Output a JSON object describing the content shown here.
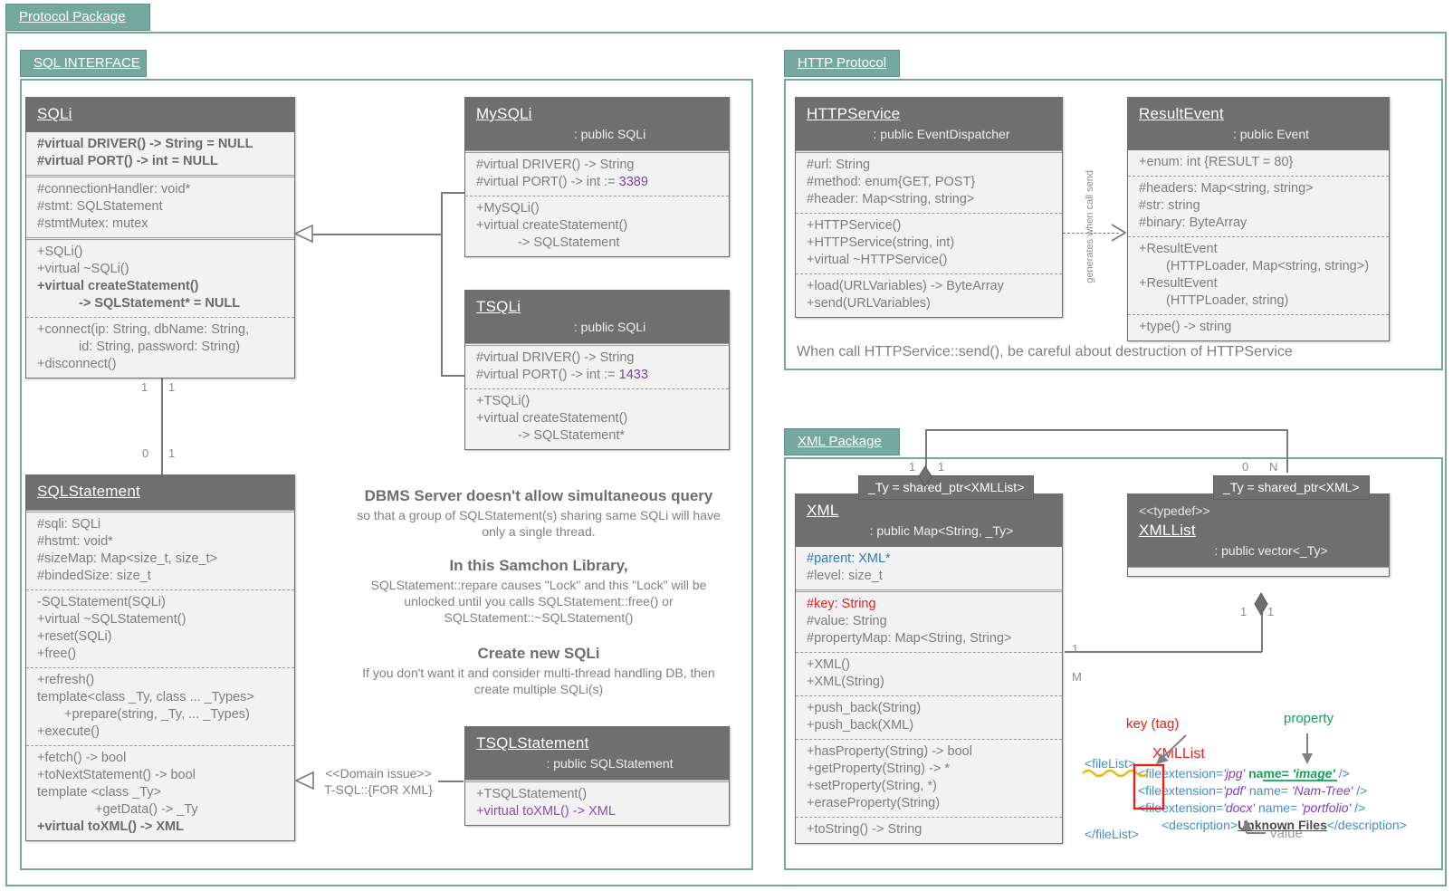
{
  "packages": {
    "protocol": {
      "title": "Protocol Package"
    },
    "sql_interface": {
      "title": "SQL INTERFACE"
    },
    "http": {
      "title": "HTTP Protocol"
    },
    "xml": {
      "title": "XML Package"
    }
  },
  "classes": {
    "sqli": {
      "name": "SQLi",
      "sections": [
        [
          "#virtual DRIVER() -> String = NULL",
          "#virtual PORT() -> int = NULL"
        ],
        [
          "#connectionHandler: void*",
          "#stmt: SQLStatement",
          "#stmtMutex: mutex"
        ],
        [
          "+SQLi()",
          "+virtual ~SQLi()",
          "+virtual createStatement()",
          "-> SQLStatement* = NULL"
        ],
        [
          "+connect(ip: String, dbName: String,",
          "id: String, password: String)",
          "+disconnect()"
        ]
      ]
    },
    "mysqli": {
      "name": "MySQLi",
      "super": ": public SQLi",
      "sections": [
        [
          "#virtual DRIVER() -> String",
          "#virtual PORT() -> int := ",
          "3389"
        ],
        [
          "+MySQLi()",
          "+virtual createStatement()",
          "-> SQLStatement"
        ]
      ]
    },
    "tsqli": {
      "name": "TSQLi",
      "super": ": public SQLi",
      "sections": [
        [
          "#virtual DRIVER() -> String",
          "#virtual PORT() -> int := ",
          "1433"
        ],
        [
          "+TSQLi()",
          "+virtual createStatement()",
          "-> SQLStatement*"
        ]
      ]
    },
    "sqlstatement": {
      "name": "SQLStatement",
      "sections": [
        [
          "#sqli: SQLi",
          "#hstmt: void*",
          "#sizeMap: Map<size_t, size_t>",
          "#bindedSize: size_t"
        ],
        [
          "-SQLStatement(SQLi)",
          "+virtual ~SQLStatement()",
          "+reset(SQLi)",
          "+free()"
        ],
        [
          "+refresh()",
          "template<class _Ty, class ... _Types>",
          "+prepare(string, _Ty, ... _Types)",
          "+execute()"
        ],
        [
          "+fetch() -> bool",
          "+toNextStatement() -> bool",
          "template <class _Ty>",
          "+getData() -> _Ty",
          "+virtual toXML() -> XML"
        ]
      ]
    },
    "tsqlstatement": {
      "name": "TSQLStatement",
      "super": ": public SQLStatement",
      "sections": [
        [
          "+TSQLStatement()",
          "+virtual toXML() -> XML"
        ]
      ]
    },
    "httpservice": {
      "name": "HTTPService",
      "super": ": public EventDispatcher",
      "sections": [
        [
          "#url: String",
          "#method: enum{GET, POST}",
          "#header: Map<string, string>"
        ],
        [
          "+HTTPService()",
          "+HTTPService(string, int)",
          "+virtual ~HTTPService()"
        ],
        [
          "+load(URLVariables) -> ByteArray",
          "+send(URLVariables)"
        ]
      ]
    },
    "resultevent": {
      "name": "ResultEvent",
      "super": ": public Event",
      "sections": [
        [
          "+enum: int {RESULT = 80}"
        ],
        [
          "#headers: Map<string, string>",
          "#str: string",
          "#binary: ByteArray"
        ],
        [
          "+ResultEvent",
          "(HTTPLoader, Map<string, string>)",
          "+ResultEvent",
          "(HTTPLoader, string)"
        ],
        [
          "+type() -> string"
        ]
      ]
    },
    "xml": {
      "name": "XML",
      "super": ": public Map<String, _Ty>",
      "sections": [
        [
          "#parent: XML*",
          "#level: size_t"
        ],
        [
          "#key: String",
          "#value: String",
          "#propertyMap: Map<String, String>"
        ],
        [
          "+XML()",
          "+XML(String)"
        ],
        [
          "+push_back(String)",
          "+push_back(XML)"
        ],
        [
          "+hasProperty(String) -> bool",
          "+getProperty(String) -> *",
          "+setProperty(String, *)",
          "+eraseProperty(String)"
        ],
        [
          "+toString() -> String"
        ]
      ]
    },
    "xmllist": {
      "stereotype": "<<typedef>>",
      "name": "XMLList",
      "super": ": public vector<_Ty>"
    }
  },
  "notes": {
    "dbms": {
      "title": "DBMS Server doesn't allow simultaneous query",
      "line1": "so that a group of SQLStatement(s) sharing same SQLi will have",
      "line2": "only a single thread."
    },
    "samchon": {
      "title": "In this Samchon Library,",
      "line1": "SQLStatement::repare causes \"Lock\" and this \"Lock\" will be",
      "line2": "unlocked until you calls SQLStatement::free() or",
      "line3": "SQLStatement::~SQLStatement()"
    },
    "newsqli": {
      "title": "Create new SQLi",
      "line1": "If you don't want it and consider multi-thread handling DB, then",
      "line2": "create multiple SQLi(s)"
    },
    "http_note": "When call HTTPService::send(), be careful about destruction of HTTPService"
  },
  "relations": {
    "domain_issue_1": "<<Domain issue>>",
    "domain_issue_2": "T-SQL::{FOR XML}",
    "generates": "generates when call send",
    "sqli_stmt": {
      "top_left": "1",
      "top_right": "1",
      "bottom_left": "0",
      "bottom_right": "1"
    },
    "xml_self": {
      "left": "1",
      "right": "1"
    },
    "xmllist_xml": {
      "left": "0",
      "right": "N"
    },
    "xmllist_agg": {
      "left": "1",
      "right": "1"
    },
    "xml_xmllist": {
      "one": "1",
      "m": "M"
    },
    "typedef_xmllist": "_Ty = shared_ptr<XMLList>",
    "typedef_xml": "_Ty = shared_ptr<XML>"
  },
  "xml_sample": {
    "label_key": "key (tag)",
    "label_property": "property",
    "label_value": "value",
    "label_xmllist": "XMLList",
    "open_tag": "<fileList>",
    "close_tag": "</fileList>",
    "rows": [
      {
        "tag": "<file",
        "attr1": "extension=",
        "val1": "'jpg'",
        "attr2": "name=",
        "val2": "'image'",
        "end": "/>"
      },
      {
        "tag": "<file",
        "attr1": "extension=",
        "val1": "'pdf'",
        "attr2": "name=",
        "val2": "'Nam-Tree'",
        "end": "/>"
      },
      {
        "tag": "<file",
        "attr1": "extension=",
        "val1": "'docx'",
        "attr2": "name=",
        "val2": "'portfolio'",
        "end": "/>"
      }
    ],
    "desc_open": "<description>",
    "desc_text": "Unknown Files",
    "desc_close": "</description>"
  },
  "colors": {
    "package": "#76a99d",
    "class_header": "#6f6f6f",
    "class_body": "#f2f2f2",
    "accent_number": "#7c3fa0",
    "key_red": "#e2231a",
    "property_green": "#15a05a",
    "parent_blue": "#2f7bbf"
  }
}
